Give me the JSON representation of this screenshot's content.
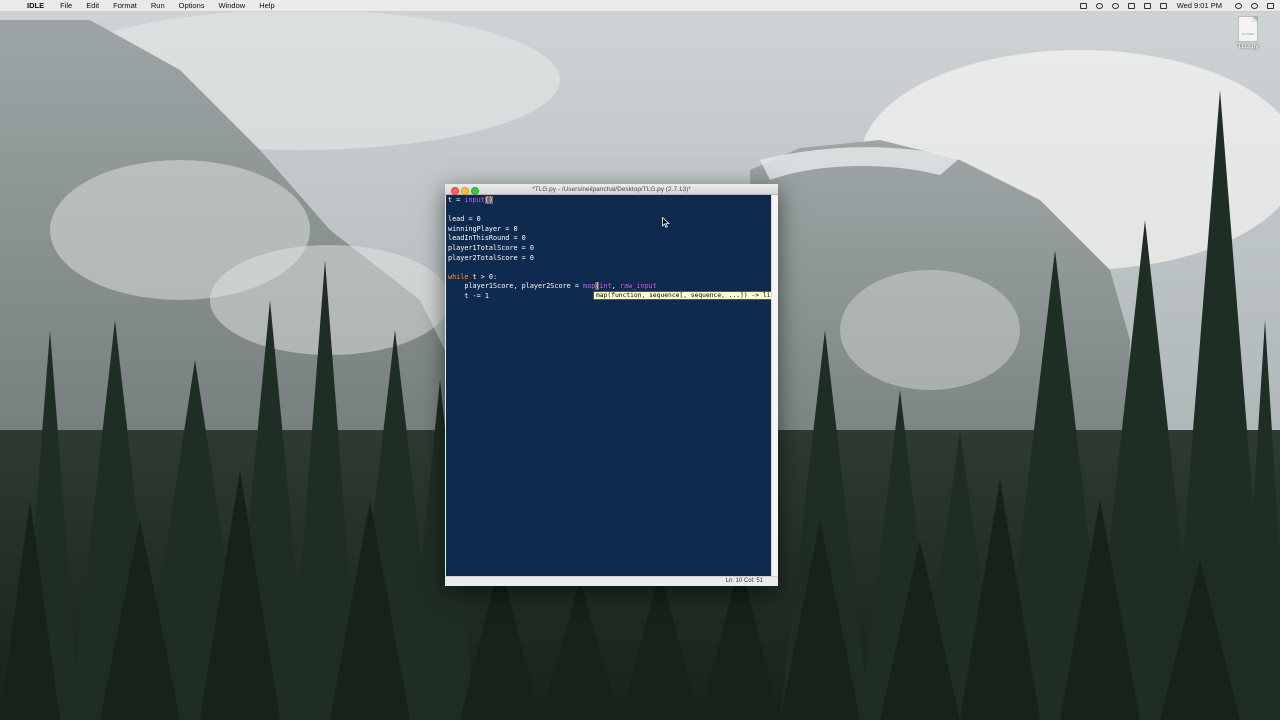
{
  "menubar": {
    "apple_glyph": "",
    "app_name": "IDLE",
    "items": [
      "File",
      "Edit",
      "Format",
      "Run",
      "Options",
      "Window",
      "Help"
    ],
    "clock": "Wed 9:01 PM"
  },
  "desktop": {
    "file_icon_name": "TLG.py",
    "file_icon_tag": "PYTHON"
  },
  "window": {
    "title": "*TLG.py - /Users/neilpanchal/Desktop/TLG.py (2.7.13)*",
    "code_lines": [
      "lead = 0",
      "winningPlayer = 0",
      "leadInThisRound = 0",
      "player1TotalScore = 0",
      "player2TotalScore = 0"
    ],
    "calltip": "map(function, sequence[, sequence, ...]) -> list",
    "status": "Ln: 10  Col: 51"
  },
  "colors": {
    "editor_background": "#0e2a4e",
    "keyword": "#ff9a3c",
    "builtin": "#c85ee6",
    "calltip_background": "#ffffd2"
  }
}
